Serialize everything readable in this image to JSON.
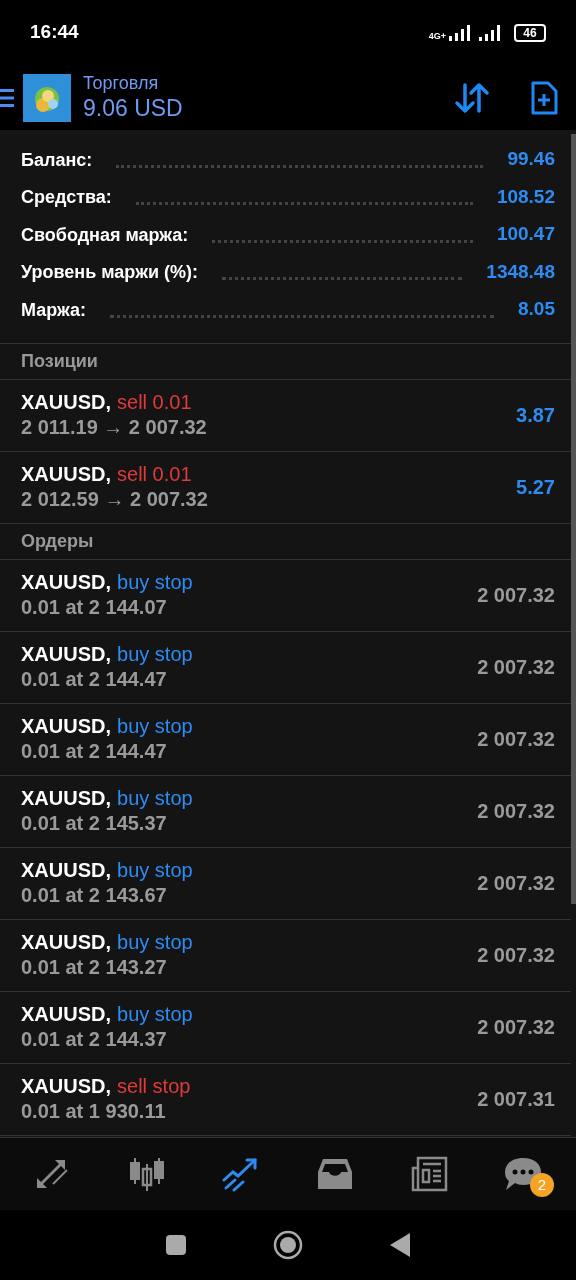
{
  "status_bar": {
    "time": "16:44",
    "network": "4G+",
    "battery": "46"
  },
  "header": {
    "title": "Торговля",
    "balance": "9.06 USD"
  },
  "summary": [
    {
      "label": "Баланс:",
      "value": "99.46"
    },
    {
      "label": "Средства:",
      "value": "108.52"
    },
    {
      "label": "Свободная маржа:",
      "value": "100.47"
    },
    {
      "label": "Уровень маржи (%):",
      "value": "1348.48"
    },
    {
      "label": "Маржа:",
      "value": "8.05"
    }
  ],
  "positions": {
    "title": "Позиции",
    "rows": [
      {
        "symbol": "XAUUSD,",
        "color": "#e03a3a",
        "type": "sell 0.01",
        "detail": "2 011.19 → 2 007.32",
        "value": "3.87"
      },
      {
        "symbol": "XAUUSD,",
        "color": "#e03a3a",
        "type": "sell 0.01",
        "detail": "2 012.59 → 2 007.32",
        "value": "5.27"
      }
    ]
  },
  "orders": {
    "title": "Ордеры",
    "rows": [
      {
        "symbol": "XAUUSD,",
        "color": "#2c8cf2",
        "type": "buy stop",
        "detail": "0.01 at 2 144.07",
        "value": "2 007.32"
      },
      {
        "symbol": "XAUUSD,",
        "color": "#2c8cf2",
        "type": "buy stop",
        "detail": "0.01 at 2 144.47",
        "value": "2 007.32"
      },
      {
        "symbol": "XAUUSD,",
        "color": "#2c8cf2",
        "type": "buy stop",
        "detail": "0.01 at 2 144.47",
        "value": "2 007.32"
      },
      {
        "symbol": "XAUUSD,",
        "color": "#2c8cf2",
        "type": "buy stop",
        "detail": "0.01 at 2 145.37",
        "value": "2 007.32"
      },
      {
        "symbol": "XAUUSD,",
        "color": "#2c8cf2",
        "type": "buy stop",
        "detail": "0.01 at 2 143.67",
        "value": "2 007.32"
      },
      {
        "symbol": "XAUUSD,",
        "color": "#2c8cf2",
        "type": "buy stop",
        "detail": "0.01 at 2 143.27",
        "value": "2 007.32"
      },
      {
        "symbol": "XAUUSD,",
        "color": "#2c8cf2",
        "type": "buy stop",
        "detail": "0.01 at 2 144.37",
        "value": "2 007.32"
      },
      {
        "symbol": "XAUUSD,",
        "color": "#e03a3a",
        "type": "sell stop",
        "detail": "0.01 at 1 930.11",
        "value": "2 007.31"
      }
    ]
  },
  "bottom_nav": [
    {
      "kind": "quotes",
      "selected": false
    },
    {
      "kind": "chart",
      "selected": false
    },
    {
      "kind": "trade",
      "selected": true
    },
    {
      "kind": "history",
      "selected": false
    },
    {
      "kind": "news",
      "selected": false
    },
    {
      "kind": "messages",
      "selected": false,
      "badge": "2"
    }
  ]
}
